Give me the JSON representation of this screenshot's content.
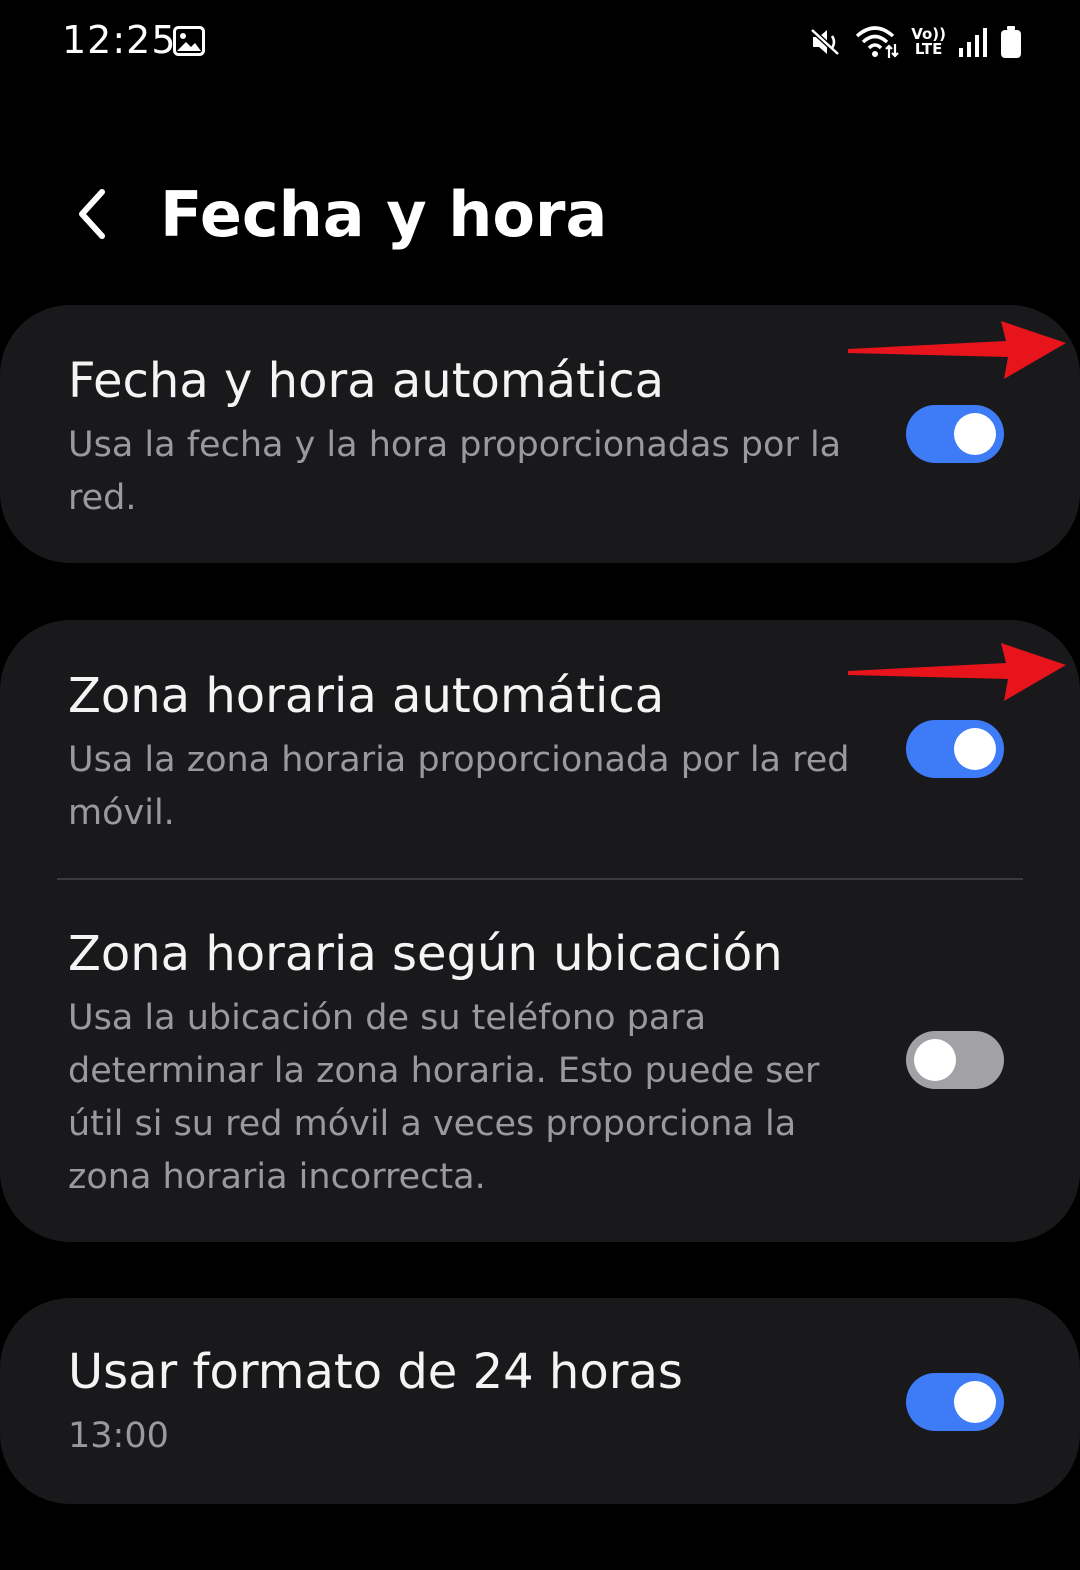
{
  "status_bar": {
    "time": "12:25",
    "icons": [
      "gallery-icon",
      "mute-icon",
      "wifi-icon",
      "volte-icon",
      "signal-icon",
      "battery-icon"
    ],
    "volte_top": "Vo))",
    "volte_bottom": "LTE"
  },
  "header": {
    "back_icon": "chevron-left-icon",
    "title": "Fecha y hora"
  },
  "settings": [
    {
      "title": "Fecha y hora automática",
      "subtitle": "Usa la fecha y la hora proporcionadas por la red.",
      "toggle": "on"
    },
    {
      "title": "Zona horaria automática",
      "subtitle": "Usa la zona horaria proporcionada por la red móvil.",
      "toggle": "on"
    },
    {
      "title": "Zona horaria según ubicación",
      "subtitle": "Usa la ubicación de su teléfono para determinar la zona horaria. Esto puede ser útil si su red móvil a veces proporciona la zona horaria incorrecta.",
      "toggle": "off"
    },
    {
      "title": "Usar formato de 24 horas",
      "subtitle": "13:00",
      "toggle": "on"
    }
  ],
  "colors": {
    "background": "#000000",
    "card": "#19191b",
    "toggle_on": "#3e7bf6",
    "toggle_off": "#a2a2a6",
    "annotation_arrow": "#e8141c"
  }
}
